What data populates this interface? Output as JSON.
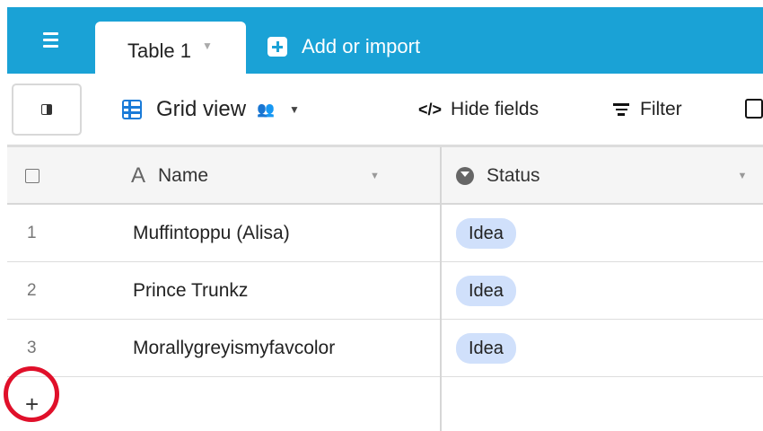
{
  "tabs": {
    "active_label": "Table 1",
    "add_import_label": "Add or import"
  },
  "toolbar": {
    "view_name": "Grid view",
    "hide_fields_label": "Hide fields",
    "filter_label": "Filter"
  },
  "grid": {
    "columns": [
      {
        "label": "Name",
        "icon": "text-field-icon"
      },
      {
        "label": "Status",
        "icon": "single-select-icon"
      }
    ],
    "rows": [
      {
        "num": "1",
        "name": "Muffintoppu (Alisa)",
        "status": "Idea"
      },
      {
        "num": "2",
        "name": "Prince Trunkz",
        "status": "Idea"
      },
      {
        "num": "3",
        "name": "Morallygreyismyfavcolor",
        "status": "Idea"
      }
    ],
    "add_row_symbol": "+"
  },
  "colors": {
    "topbar": "#1aa2d6",
    "badge": "#d0e0fb",
    "annotation_circle": "#e0102a"
  }
}
